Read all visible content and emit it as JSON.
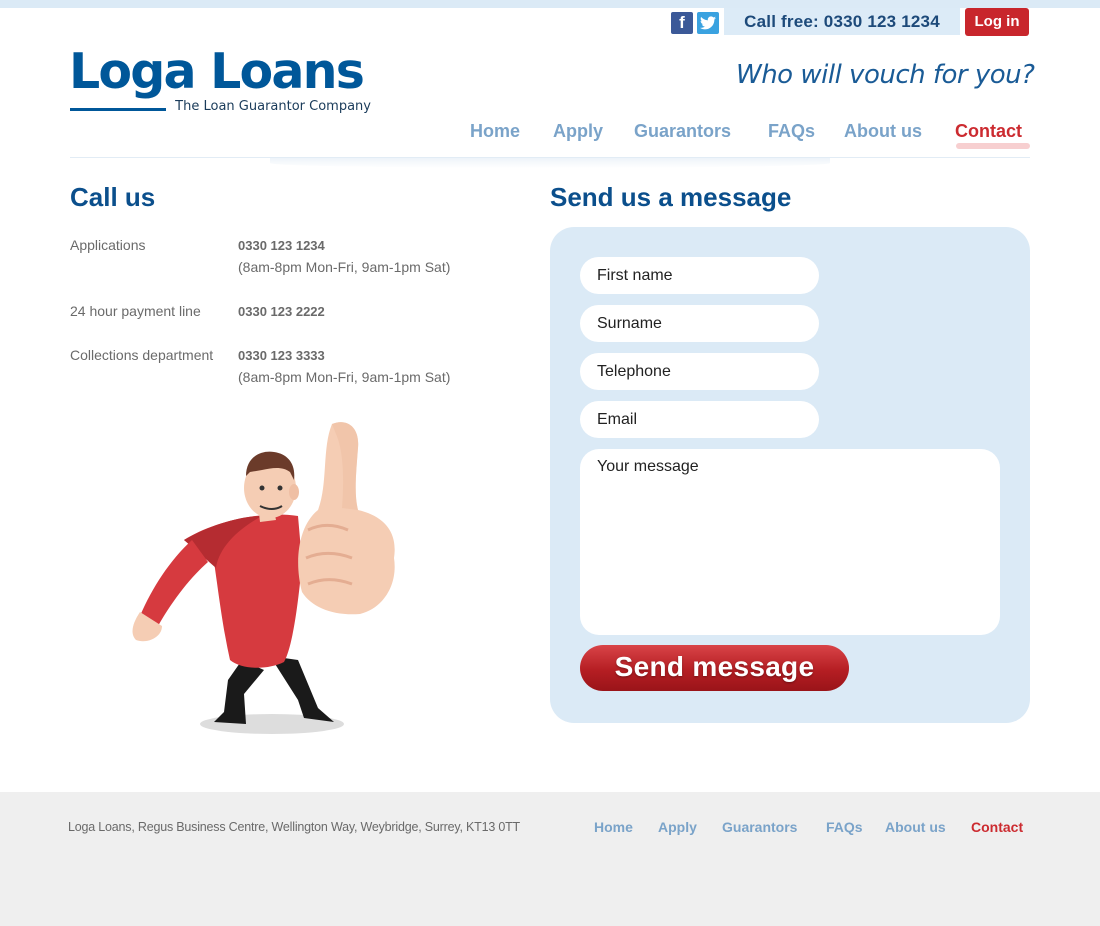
{
  "header": {
    "call_free": "Call free: 0330 123 1234",
    "login_label": "Log in",
    "facebook_glyph": "f",
    "tagline": "Who will vouch for you?"
  },
  "logo": {
    "title": "Loga Loans",
    "subtitle": "The Loan Guarantor Company"
  },
  "nav": {
    "items": [
      {
        "label": "Home"
      },
      {
        "label": "Apply"
      },
      {
        "label": "Guarantors"
      },
      {
        "label": "FAQs"
      },
      {
        "label": "About us"
      },
      {
        "label": "Contact",
        "active": true
      }
    ]
  },
  "call_us": {
    "heading": "Call us",
    "rows": [
      {
        "label": "Applications",
        "number": "0330 123 1234",
        "hours": "(8am-8pm Mon-Fri, 9am-1pm Sat)"
      },
      {
        "label": "24 hour payment line",
        "number": "0330 123 2222",
        "hours": ""
      },
      {
        "label": "Collections department",
        "number": "0330 123 3333",
        "hours": "(8am-8pm Mon-Fri, 9am-1pm Sat)"
      }
    ]
  },
  "form": {
    "heading": "Send us a message",
    "first_name_placeholder": "First name",
    "surname_placeholder": "Surname",
    "telephone_placeholder": "Telephone",
    "email_placeholder": "Email",
    "message_placeholder": "Your message",
    "send_label": "Send message"
  },
  "footer": {
    "address": "Loga Loans, Regus Business Centre, Wellington Way, Weybridge, Surrey, KT13 0TT",
    "nav": [
      {
        "label": "Home"
      },
      {
        "label": "Apply"
      },
      {
        "label": "Guarantors"
      },
      {
        "label": "FAQs"
      },
      {
        "label": "About us"
      },
      {
        "label": "Contact",
        "active": true
      }
    ]
  },
  "colors": {
    "brand_blue": "#005799",
    "nav_blue": "#7aa3c9",
    "accent_red": "#cc2b30",
    "panel_blue": "#dbeaf6",
    "footer_grey": "#efefef"
  }
}
